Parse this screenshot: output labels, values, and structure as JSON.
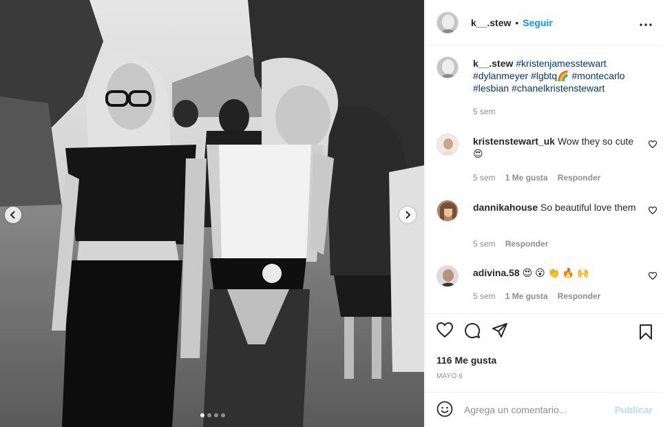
{
  "post": {
    "username": "k__.stew",
    "separator": "•",
    "follow_label": "Seguir",
    "caption_tags": "#kristenjamesstewart #dylanmeyer #lgbtq🌈 #montecarlo #lesbian #chanelkristenstewart",
    "caption_time": "5 sem",
    "likes": "116 Me gusta",
    "date": "MAYO 6",
    "carousel": {
      "count": 4,
      "active_index": 0
    }
  },
  "comments": [
    {
      "username": "kristenstewart_uk",
      "text": "Wow they so cute 😍",
      "time": "5 sem",
      "likes": "1 Me gusta",
      "reply": "Responder"
    },
    {
      "username": "dannikahouse",
      "text": "So beautiful love them",
      "time": "5 sem",
      "likes": "",
      "reply": "Responder"
    },
    {
      "username": "adivina.58",
      "text": "😍 😮 👏 🔥 🙌",
      "time": "5 sem",
      "likes": "1 Me gusta",
      "reply": "Responder"
    }
  ],
  "add_comment": {
    "placeholder": "Agrega un comentario...",
    "post_label": "Publicar"
  },
  "icons": [
    "more-icon",
    "heart-icon",
    "comment-icon",
    "share-icon",
    "bookmark-icon",
    "emoji-icon",
    "chevron-left-icon",
    "chevron-right-icon"
  ],
  "colors": {
    "link": "#0095f6",
    "hashtag": "#00376b",
    "muted": "#8e8e8e",
    "post_disabled": "#b2dffc"
  }
}
